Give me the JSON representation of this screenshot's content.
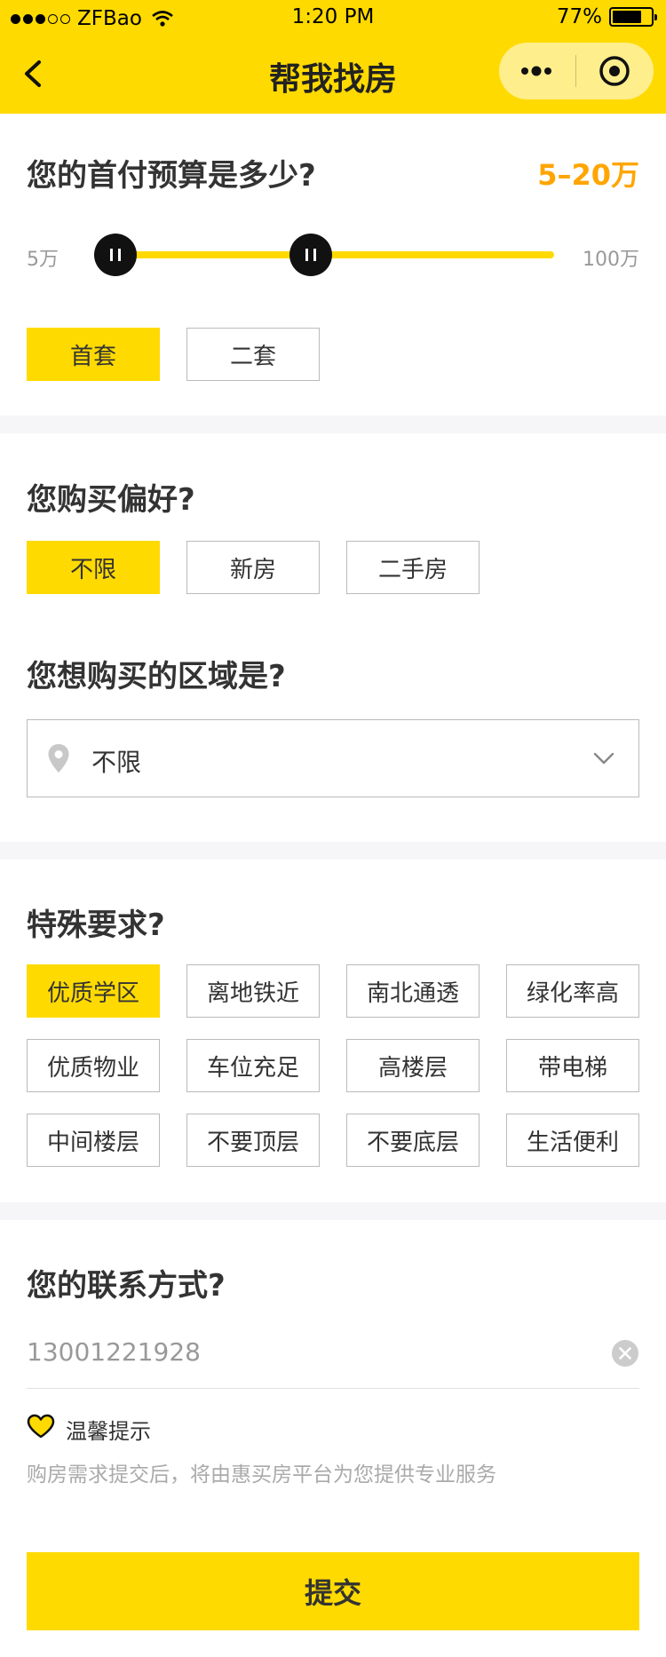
{
  "status_bar": {
    "carrier": "ZFBao",
    "time": "1:20 PM",
    "battery": "77%",
    "battery_level": 0.77
  },
  "nav": {
    "title": "帮我找房"
  },
  "budget": {
    "question": "您的首付预算是多少?",
    "value": "5–20万",
    "min_label": "5万",
    "max_label": "100万",
    "range_min": 5,
    "range_max": 100,
    "selected_low": 5,
    "selected_high": 20,
    "options": [
      {
        "label": "首套",
        "selected": true
      },
      {
        "label": "二套",
        "selected": false
      }
    ]
  },
  "preference": {
    "question": "您购买偏好?",
    "options": [
      {
        "label": "不限",
        "selected": true
      },
      {
        "label": "新房",
        "selected": false
      },
      {
        "label": "二手房",
        "selected": false
      }
    ]
  },
  "region": {
    "question": "您想购买的区域是?",
    "value": "不限"
  },
  "special": {
    "question": "特殊要求?",
    "options": [
      {
        "label": "优质学区",
        "selected": true
      },
      {
        "label": "离地铁近",
        "selected": false
      },
      {
        "label": "南北通透",
        "selected": false
      },
      {
        "label": "绿化率高",
        "selected": false
      },
      {
        "label": "优质物业",
        "selected": false
      },
      {
        "label": "车位充足",
        "selected": false
      },
      {
        "label": "高楼层",
        "selected": false
      },
      {
        "label": "带电梯",
        "selected": false
      },
      {
        "label": "中间楼层",
        "selected": false
      },
      {
        "label": "不要顶层",
        "selected": false
      },
      {
        "label": "不要底层",
        "selected": false
      },
      {
        "label": "生活便利",
        "selected": false
      }
    ]
  },
  "contact": {
    "question": "您的联系方式?",
    "phone": "13001221928"
  },
  "tip": {
    "title": "温馨提示",
    "text": "购房需求提交后，将由惠买房平台为您提供专业服务"
  },
  "submit_label": "提交",
  "colors": {
    "accent": "#FFDA00",
    "highlight": "#FFA500",
    "text": "#333333",
    "muted": "#999999"
  }
}
